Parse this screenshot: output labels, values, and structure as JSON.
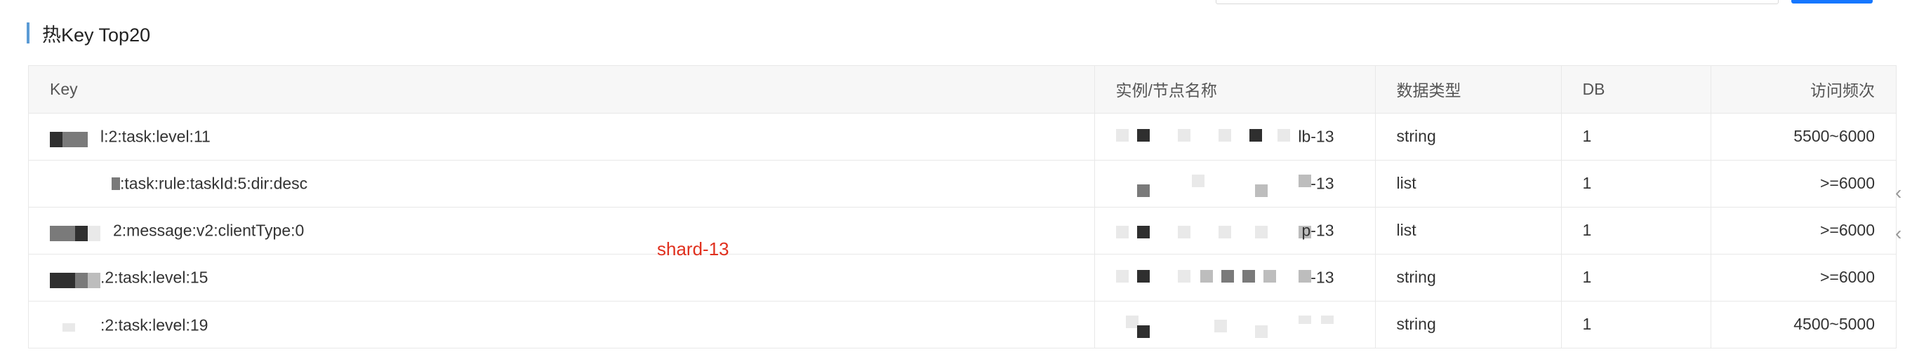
{
  "section": {
    "title": "热Key Top20"
  },
  "table": {
    "columns": [
      "Key",
      "实例/节点名称",
      "数据类型",
      "DB",
      "访问频次"
    ],
    "rows": [
      {
        "key": "l:2:task:level:11",
        "instance": "lb-13",
        "type": "string",
        "db": "1",
        "freq": "5500~6000"
      },
      {
        "key": ":task:rule:taskId:5:dir:desc",
        "instance": "-13",
        "type": "list",
        "db": "1",
        "freq": ">=6000"
      },
      {
        "key": "2:message:v2:clientType:0",
        "instance": "p-13",
        "type": "list",
        "db": "1",
        "freq": ">=6000"
      },
      {
        "key": ".2:task:level:15",
        "instance": "-13",
        "type": "string",
        "db": "1",
        "freq": ">=6000"
      },
      {
        "key": ":2:task:level:19",
        "instance": "",
        "type": "string",
        "db": "1",
        "freq": "4500~5000"
      }
    ]
  },
  "annotation": {
    "text": "shard-13",
    "color": "#e0301e"
  },
  "colors": {
    "accent": "#5b9bd5",
    "primary_button": "#1677ff"
  }
}
